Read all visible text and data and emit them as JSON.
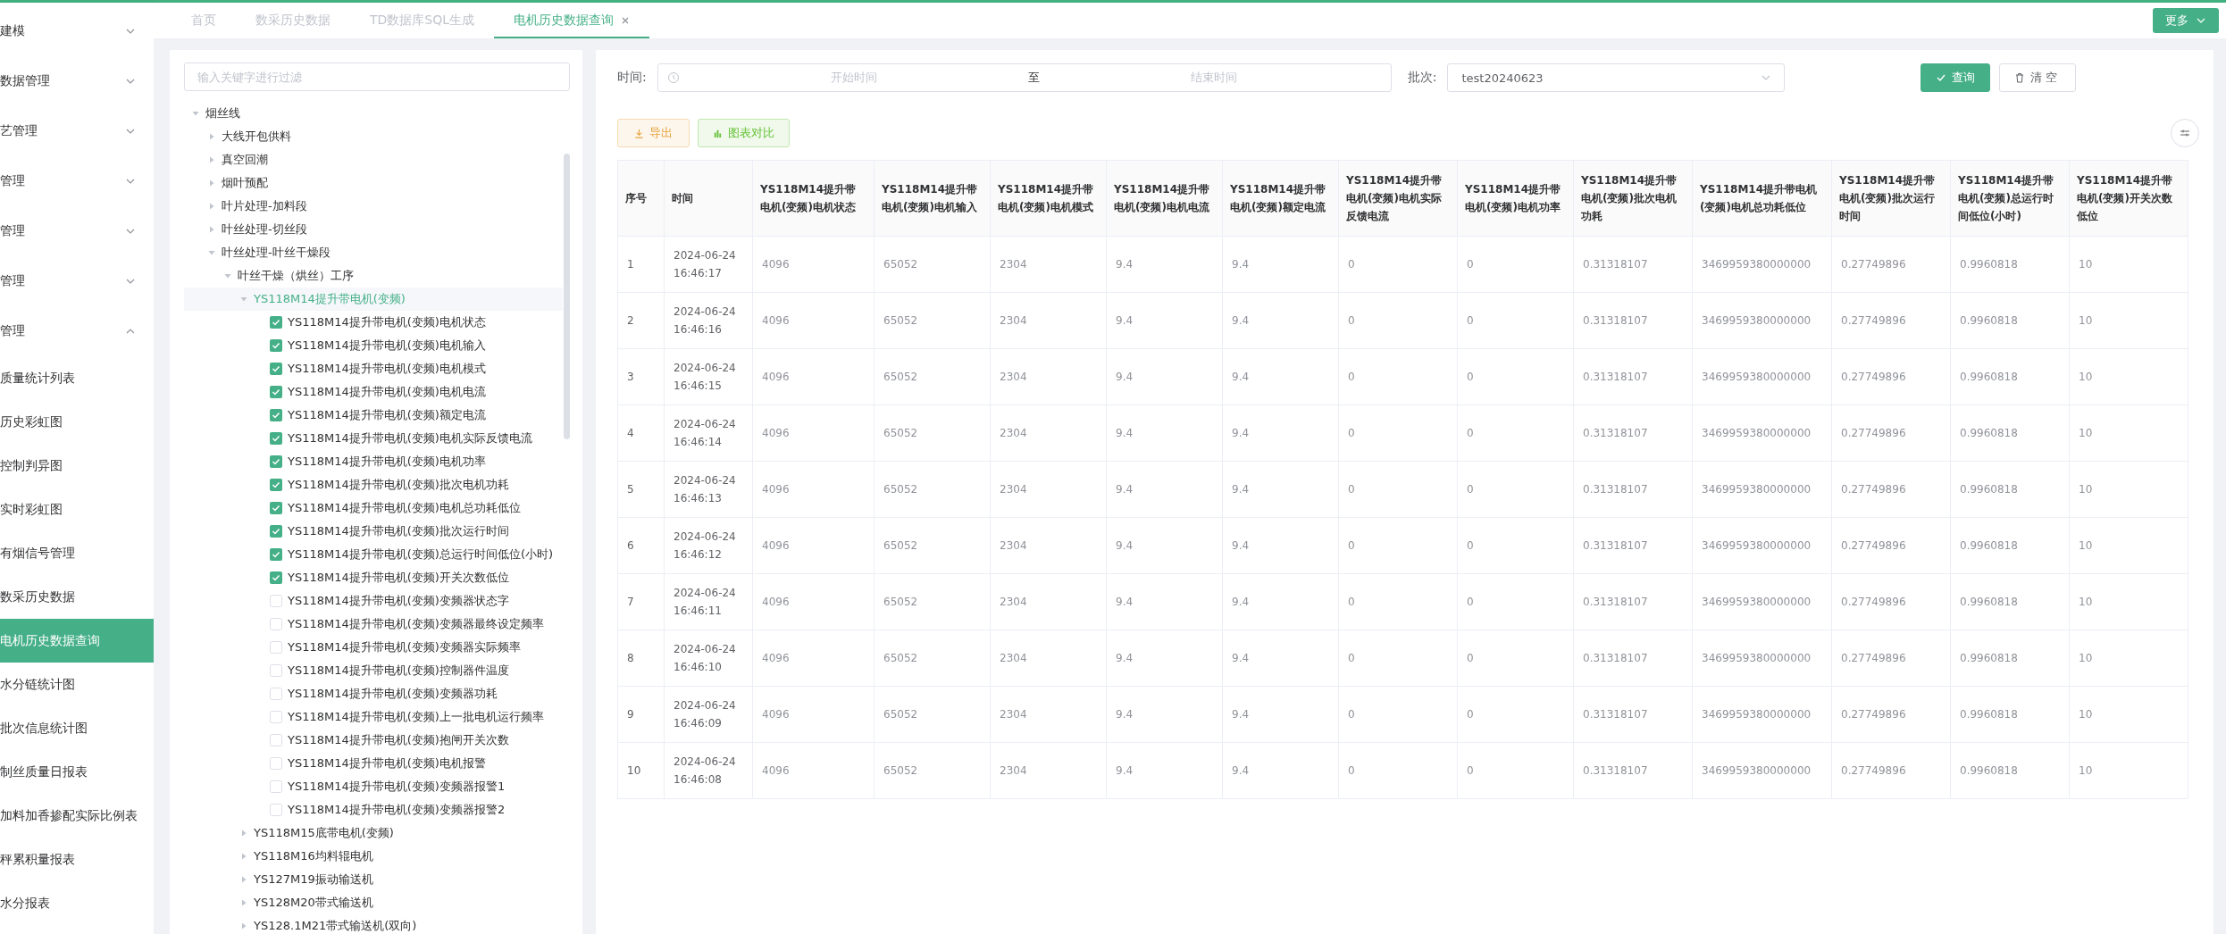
{
  "sidebar": {
    "items": [
      {
        "label": "建模",
        "kind": "group",
        "expanded": false
      },
      {
        "label": "数据管理",
        "kind": "group",
        "expanded": false
      },
      {
        "label": "艺管理",
        "kind": "group",
        "expanded": false
      },
      {
        "label": "管理",
        "kind": "group",
        "expanded": false
      },
      {
        "label": "管理",
        "kind": "group",
        "expanded": false
      },
      {
        "label": "管理",
        "kind": "group",
        "expanded": false
      },
      {
        "label": "管理",
        "kind": "group",
        "expanded": true
      },
      {
        "label": "质量统计列表",
        "kind": "link",
        "selected": false
      },
      {
        "label": "历史彩虹图",
        "kind": "link",
        "selected": false
      },
      {
        "label": "控制判异图",
        "kind": "link",
        "selected": false
      },
      {
        "label": "实时彩虹图",
        "kind": "link",
        "selected": false
      },
      {
        "label": "有烟信号管理",
        "kind": "link",
        "selected": false
      },
      {
        "label": "数采历史数据",
        "kind": "link",
        "selected": false
      },
      {
        "label": "电机历史数据查询",
        "kind": "link",
        "selected": true
      },
      {
        "label": "水分链统计图",
        "kind": "link",
        "selected": false
      },
      {
        "label": "批次信息统计图",
        "kind": "link",
        "selected": false
      },
      {
        "label": "制丝质量日报表",
        "kind": "link",
        "selected": false
      },
      {
        "label": "加料加香掺配实际比例表",
        "kind": "link",
        "selected": false
      },
      {
        "label": "秤累积量报表",
        "kind": "link",
        "selected": false
      },
      {
        "label": "水分报表",
        "kind": "link",
        "selected": false
      }
    ]
  },
  "tabs": [
    {
      "label": "首页",
      "selected": false,
      "closable": false
    },
    {
      "label": "数采历史数据",
      "selected": false,
      "closable": false
    },
    {
      "label": "TD数据库SQL生成",
      "selected": false,
      "closable": false
    },
    {
      "label": "电机历史数据查询",
      "selected": true,
      "closable": true
    }
  ],
  "more_button": "更多",
  "tree": {
    "filter_placeholder": "输入关键字进行过滤",
    "nodes": [
      {
        "kind": "group",
        "label": "烟丝线",
        "expanded": true,
        "selected": false,
        "children": [
          {
            "kind": "group",
            "label": "大线开包供料",
            "expanded": false,
            "selected": false
          },
          {
            "kind": "group",
            "label": "真空回潮",
            "expanded": false,
            "selected": false
          },
          {
            "kind": "group",
            "label": "烟叶预配",
            "expanded": false,
            "selected": false
          },
          {
            "kind": "group",
            "label": "叶片处理-加料段",
            "expanded": false,
            "selected": false
          },
          {
            "kind": "group",
            "label": "叶丝处理-切丝段",
            "expanded": false,
            "selected": false
          },
          {
            "kind": "group",
            "label": "叶丝处理-叶丝干燥段",
            "expanded": true,
            "selected": false,
            "children": [
              {
                "kind": "group",
                "label": "叶丝干燥（烘丝）工序",
                "expanded": true,
                "selected": false,
                "children": [
                  {
                    "kind": "group",
                    "label": "YS118M14提升带电机(变频)",
                    "expanded": true,
                    "selected": true,
                    "children": [
                      {
                        "kind": "leaf",
                        "label": "YS118M14提升带电机(变频)电机状态",
                        "checked": true
                      },
                      {
                        "kind": "leaf",
                        "label": "YS118M14提升带电机(变频)电机输入",
                        "checked": true
                      },
                      {
                        "kind": "leaf",
                        "label": "YS118M14提升带电机(变频)电机模式",
                        "checked": true
                      },
                      {
                        "kind": "leaf",
                        "label": "YS118M14提升带电机(变频)电机电流",
                        "checked": true
                      },
                      {
                        "kind": "leaf",
                        "label": "YS118M14提升带电机(变频)额定电流",
                        "checked": true
                      },
                      {
                        "kind": "leaf",
                        "label": "YS118M14提升带电机(变频)电机实际反馈电流",
                        "checked": true
                      },
                      {
                        "kind": "leaf",
                        "label": "YS118M14提升带电机(变频)电机功率",
                        "checked": true
                      },
                      {
                        "kind": "leaf",
                        "label": "YS118M14提升带电机(变频)批次电机功耗",
                        "checked": true
                      },
                      {
                        "kind": "leaf",
                        "label": "YS118M14提升带电机(变频)电机总功耗低位",
                        "checked": true
                      },
                      {
                        "kind": "leaf",
                        "label": "YS118M14提升带电机(变频)批次运行时间",
                        "checked": true
                      },
                      {
                        "kind": "leaf",
                        "label": "YS118M14提升带电机(变频)总运行时间低位(小时)",
                        "checked": true
                      },
                      {
                        "kind": "leaf",
                        "label": "YS118M14提升带电机(变频)开关次数低位",
                        "checked": true
                      },
                      {
                        "kind": "leaf",
                        "label": "YS118M14提升带电机(变频)变频器状态字",
                        "checked": false
                      },
                      {
                        "kind": "leaf",
                        "label": "YS118M14提升带电机(变频)变频器最终设定频率",
                        "checked": false
                      },
                      {
                        "kind": "leaf",
                        "label": "YS118M14提升带电机(变频)变频器实际频率",
                        "checked": false
                      },
                      {
                        "kind": "leaf",
                        "label": "YS118M14提升带电机(变频)控制器件温度",
                        "checked": false
                      },
                      {
                        "kind": "leaf",
                        "label": "YS118M14提升带电机(变频)变频器功耗",
                        "checked": false
                      },
                      {
                        "kind": "leaf",
                        "label": "YS118M14提升带电机(变频)上一批电机运行频率",
                        "checked": false
                      },
                      {
                        "kind": "leaf",
                        "label": "YS118M14提升带电机(变频)抱闸开关次数",
                        "checked": false
                      },
                      {
                        "kind": "leaf",
                        "label": "YS118M14提升带电机(变频)电机报警",
                        "checked": false
                      },
                      {
                        "kind": "leaf",
                        "label": "YS118M14提升带电机(变频)变频器报警1",
                        "checked": false
                      },
                      {
                        "kind": "leaf",
                        "label": "YS118M14提升带电机(变频)变频器报警2",
                        "checked": false
                      }
                    ]
                  },
                  {
                    "kind": "group",
                    "label": "YS118M15底带电机(变频)",
                    "expanded": false,
                    "selected": false
                  },
                  {
                    "kind": "group",
                    "label": "YS118M16均料辊电机",
                    "expanded": false,
                    "selected": false
                  },
                  {
                    "kind": "group",
                    "label": "YS127M19振动输送机",
                    "expanded": false,
                    "selected": false
                  },
                  {
                    "kind": "group",
                    "label": "YS128M20带式输送机",
                    "expanded": false,
                    "selected": false
                  },
                  {
                    "kind": "group",
                    "label": "YS128.1M21带式输送机(双向)",
                    "expanded": false,
                    "selected": false
                  }
                ]
              }
            ]
          }
        ]
      }
    ]
  },
  "query": {
    "time_label": "时间:",
    "start_placeholder": "开始时间",
    "separator": "至",
    "end_placeholder": "结束时间",
    "batch_label": "批次:",
    "batch_value": "test20240623",
    "search_button": "查询",
    "clear_button": "清空"
  },
  "toolbar": {
    "export_button": "导出",
    "compare_button": "图表对比"
  },
  "table": {
    "columns": [
      "序号",
      "时间",
      "YS118M14提升带电机(变频)电机状态",
      "YS118M14提升带电机(变频)电机输入",
      "YS118M14提升带电机(变频)电机模式",
      "YS118M14提升带电机(变频)电机电流",
      "YS118M14提升带电机(变频)额定电流",
      "YS118M14提升带电机(变频)电机实际反馈电流",
      "YS118M14提升带电机(变频)电机功率",
      "YS118M14提升带电机(变频)批次电机功耗",
      "YS118M14提升带电机(变频)电机总功耗低位",
      "YS118M14提升带电机(变频)批次运行时间",
      "YS118M14提升带电机(变频)总运行时间低位(小时)",
      "YS118M14提升带电机(变频)开关次数低位"
    ],
    "rows": [
      [
        "1",
        "2024-06-24 16:46:17",
        "4096",
        "65052",
        "2304",
        "9.4",
        "9.4",
        "0",
        "0",
        "0.31318107",
        "3469959380000000",
        "0.27749896",
        "0.9960818",
        "10"
      ],
      [
        "2",
        "2024-06-24 16:46:16",
        "4096",
        "65052",
        "2304",
        "9.4",
        "9.4",
        "0",
        "0",
        "0.31318107",
        "3469959380000000",
        "0.27749896",
        "0.9960818",
        "10"
      ],
      [
        "3",
        "2024-06-24 16:46:15",
        "4096",
        "65052",
        "2304",
        "9.4",
        "9.4",
        "0",
        "0",
        "0.31318107",
        "3469959380000000",
        "0.27749896",
        "0.9960818",
        "10"
      ],
      [
        "4",
        "2024-06-24 16:46:14",
        "4096",
        "65052",
        "2304",
        "9.4",
        "9.4",
        "0",
        "0",
        "0.31318107",
        "3469959380000000",
        "0.27749896",
        "0.9960818",
        "10"
      ],
      [
        "5",
        "2024-06-24 16:46:13",
        "4096",
        "65052",
        "2304",
        "9.4",
        "9.4",
        "0",
        "0",
        "0.31318107",
        "3469959380000000",
        "0.27749896",
        "0.9960818",
        "10"
      ],
      [
        "6",
        "2024-06-24 16:46:12",
        "4096",
        "65052",
        "2304",
        "9.4",
        "9.4",
        "0",
        "0",
        "0.31318107",
        "3469959380000000",
        "0.27749896",
        "0.9960818",
        "10"
      ],
      [
        "7",
        "2024-06-24 16:46:11",
        "4096",
        "65052",
        "2304",
        "9.4",
        "9.4",
        "0",
        "0",
        "0.31318107",
        "3469959380000000",
        "0.27749896",
        "0.9960818",
        "10"
      ],
      [
        "8",
        "2024-06-24 16:46:10",
        "4096",
        "65052",
        "2304",
        "9.4",
        "9.4",
        "0",
        "0",
        "0.31318107",
        "3469959380000000",
        "0.27749896",
        "0.9960818",
        "10"
      ],
      [
        "9",
        "2024-06-24 16:46:09",
        "4096",
        "65052",
        "2304",
        "9.4",
        "9.4",
        "0",
        "0",
        "0.31318107",
        "3469959380000000",
        "0.27749896",
        "0.9960818",
        "10"
      ],
      [
        "10",
        "2024-06-24 16:46:08",
        "4096",
        "65052",
        "2304",
        "9.4",
        "9.4",
        "0",
        "0",
        "0.31318107",
        "3469959380000000",
        "0.27749896",
        "0.9960818",
        "10"
      ]
    ]
  }
}
